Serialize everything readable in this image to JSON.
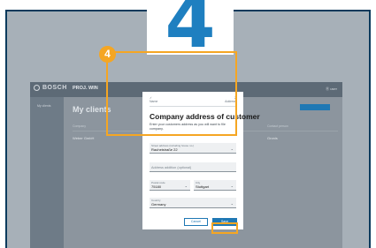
{
  "step": {
    "number": "4"
  },
  "callout": {
    "badge": "4",
    "accent": "#f5a623"
  },
  "app": {
    "brand": "BOSCH",
    "name": "PROJ. WIN",
    "user": "Ⓡ user",
    "sidebar_item": "My clients",
    "page_title": "My clients",
    "columns": [
      "Company",
      "Contact person"
    ],
    "rows": [
      [
        "Weber GmbH",
        "Gronis"
      ]
    ]
  },
  "modal": {
    "stepper": {
      "step1": "Name",
      "step2": "Address"
    },
    "title": "Company address of customer",
    "description": "Enter your customers address as you will want to file company.",
    "fields": {
      "street": {
        "label": "Street address (including house no.)",
        "value": "Rauheistraße 22"
      },
      "address2": {
        "placeholder": "Address addition (optional)"
      },
      "postcode": {
        "label": "Postal code",
        "value": "75180"
      },
      "city": {
        "label": "City",
        "value": "Stuttgart"
      },
      "country": {
        "label": "Country",
        "value": "Germany"
      }
    },
    "buttons": {
      "cancel": "Cancel",
      "save": "Save"
    }
  }
}
